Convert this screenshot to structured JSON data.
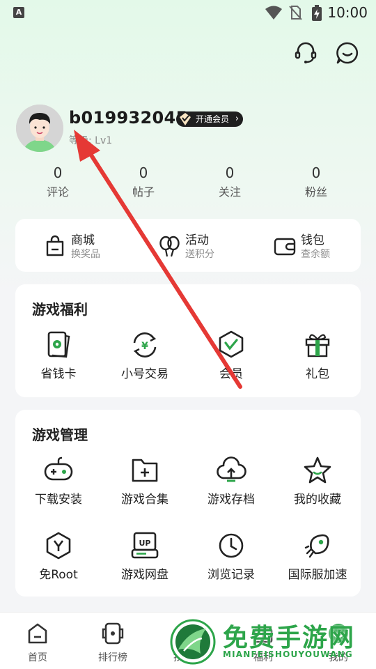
{
  "status_bar": {
    "time": "10:00",
    "app_badge": "A"
  },
  "profile": {
    "username": "b019932045",
    "vip_label": "开通会员",
    "vip_chevron": "›",
    "level": "等级: Lv1"
  },
  "stats": [
    {
      "value": "0",
      "label": "评论"
    },
    {
      "value": "0",
      "label": "帖子"
    },
    {
      "value": "0",
      "label": "关注"
    },
    {
      "value": "0",
      "label": "粉丝"
    }
  ],
  "shortcuts": [
    {
      "title": "商城",
      "subtitle": "换奖品",
      "icon": "shopping-bag-icon"
    },
    {
      "title": "活动",
      "subtitle": "送积分",
      "icon": "balloons-icon"
    },
    {
      "title": "钱包",
      "subtitle": "查余额",
      "icon": "wallet-icon"
    }
  ],
  "welfare": {
    "title": "游戏福利",
    "items": [
      {
        "label": "省钱卡",
        "icon": "money-card-icon"
      },
      {
        "label": "小号交易",
        "icon": "yuan-exchange-icon"
      },
      {
        "label": "会员",
        "icon": "vip-shield-icon"
      },
      {
        "label": "礼包",
        "icon": "gift-icon"
      }
    ]
  },
  "management": {
    "title": "游戏管理",
    "items": [
      {
        "label": "下载安装",
        "icon": "gamepad-icon"
      },
      {
        "label": "游戏合集",
        "icon": "folder-plus-icon"
      },
      {
        "label": "游戏存档",
        "icon": "cloud-upload-icon"
      },
      {
        "label": "我的收藏",
        "icon": "star-icon"
      },
      {
        "label": "免Root",
        "icon": "y-hexagon-icon"
      },
      {
        "label": "游戏网盘",
        "icon": "up-drive-icon"
      },
      {
        "label": "浏览记录",
        "icon": "clock-icon"
      },
      {
        "label": "国际服加速",
        "icon": "rocket-icon"
      }
    ]
  },
  "bottom_nav": [
    {
      "label": "首页",
      "icon": "home-icon"
    },
    {
      "label": "排行榜",
      "icon": "ranking-icon"
    },
    {
      "label": "找游戏",
      "icon": "find-game-icon"
    },
    {
      "label": "福利",
      "icon": "welfare-icon"
    },
    {
      "label": "我的",
      "icon": "profile-icon"
    }
  ],
  "watermark": {
    "text": "免费手游网",
    "subtext": "MIANFEISHOUYOUWANG"
  },
  "colors": {
    "brand_green": "#2da54a",
    "arrow_red": "#e53935",
    "vip_badge_bg": "#1f1f1f"
  }
}
